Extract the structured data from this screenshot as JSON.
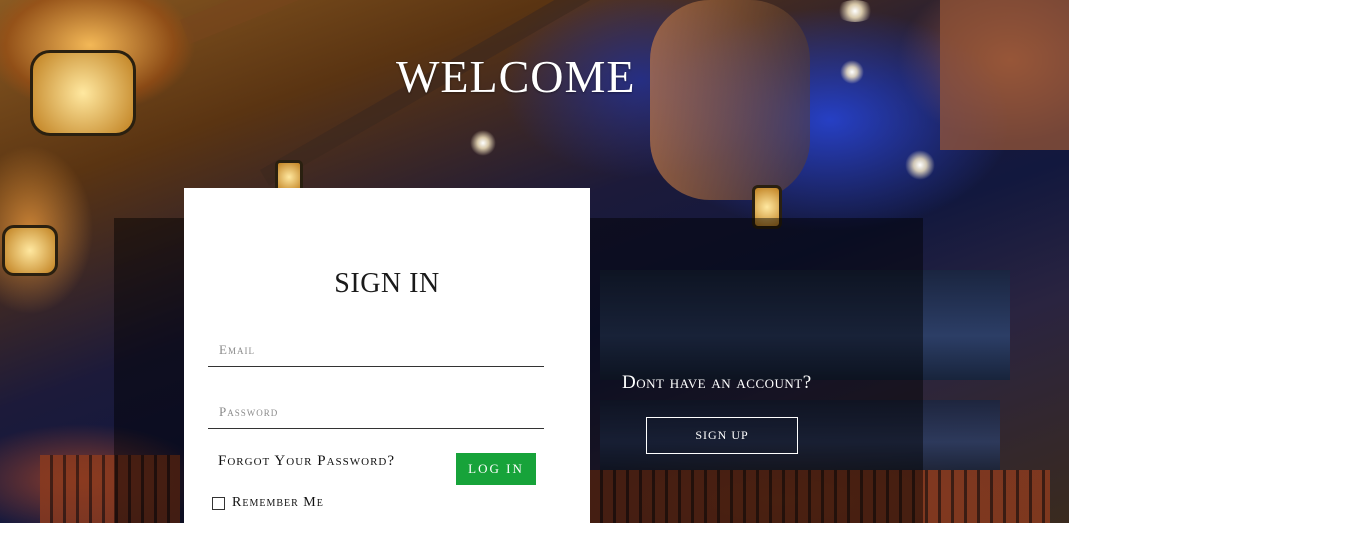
{
  "hero": {
    "title": "WELCOME"
  },
  "signin": {
    "title": "SIGN IN",
    "email_placeholder": "Email",
    "password_placeholder": "Password",
    "forgot_label": "Forgot Your Password?",
    "login_label": "LOG IN",
    "remember_label": "Remember Me",
    "login_color": "#17a33a"
  },
  "signup": {
    "prompt": "Dont have an account?",
    "button_label": "SIGN UP"
  }
}
